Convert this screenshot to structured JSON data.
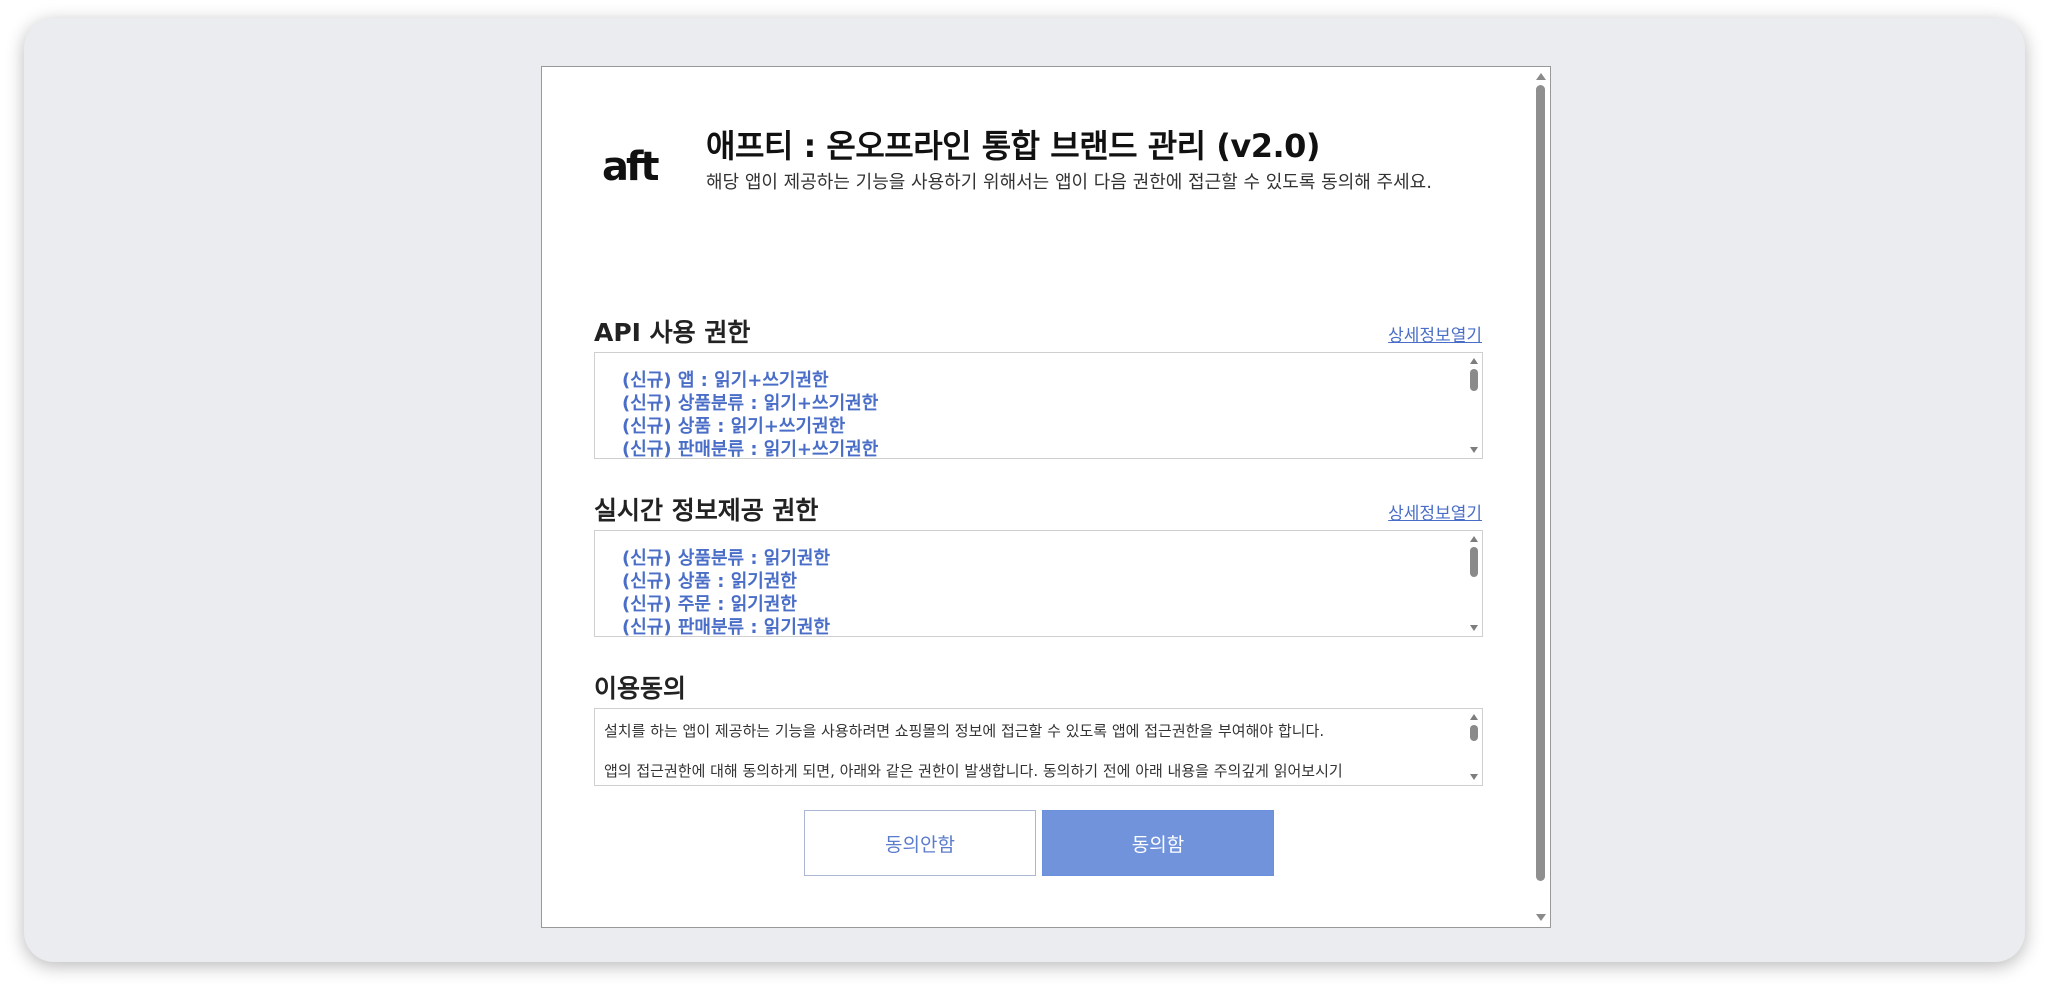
{
  "app": {
    "logo_text": "aft",
    "title": "애프티 : 온오프라인 통합 브랜드 관리 (v2.0)",
    "description": "해당 앱이 제공하는 기능을 사용하기 위해서는 앱이 다음 권한에 접근할 수 있도록 동의해 주세요."
  },
  "api_permissions": {
    "title": "API 사용 권한",
    "detail_link": "상세정보열기",
    "items": [
      "(신규) 앱 : 읽기+쓰기권한",
      "(신규) 상품분류 : 읽기+쓰기권한",
      "(신규) 상품 : 읽기+쓰기권한",
      "(신규) 판매분류 : 읽기+쓰기권한"
    ]
  },
  "realtime_permissions": {
    "title": "실시간 정보제공 권한",
    "detail_link": "상세정보열기",
    "items": [
      "(신규) 상품분류 : 읽기권한",
      "(신규) 상품 : 읽기권한",
      "(신규) 주문 : 읽기권한",
      "(신규) 판매분류 : 읽기권한"
    ]
  },
  "consent": {
    "title": "이용동의",
    "paragraphs": [
      "설치를 하는 앱이 제공하는 기능을 사용하려면 쇼핑몰의 정보에 접근할 수 있도록 앱에 접근권한을 부여해야 합니다.",
      "앱의 접근권한에 대해 동의하게 되면, 아래와 같은 권한이 발생합니다. 동의하기 전에 아래 내용을 주의깊게 읽어보시기"
    ]
  },
  "buttons": {
    "decline": "동의안함",
    "agree": "동의함"
  },
  "colors": {
    "accent": "#7093dc",
    "link": "#4a6ec7"
  }
}
